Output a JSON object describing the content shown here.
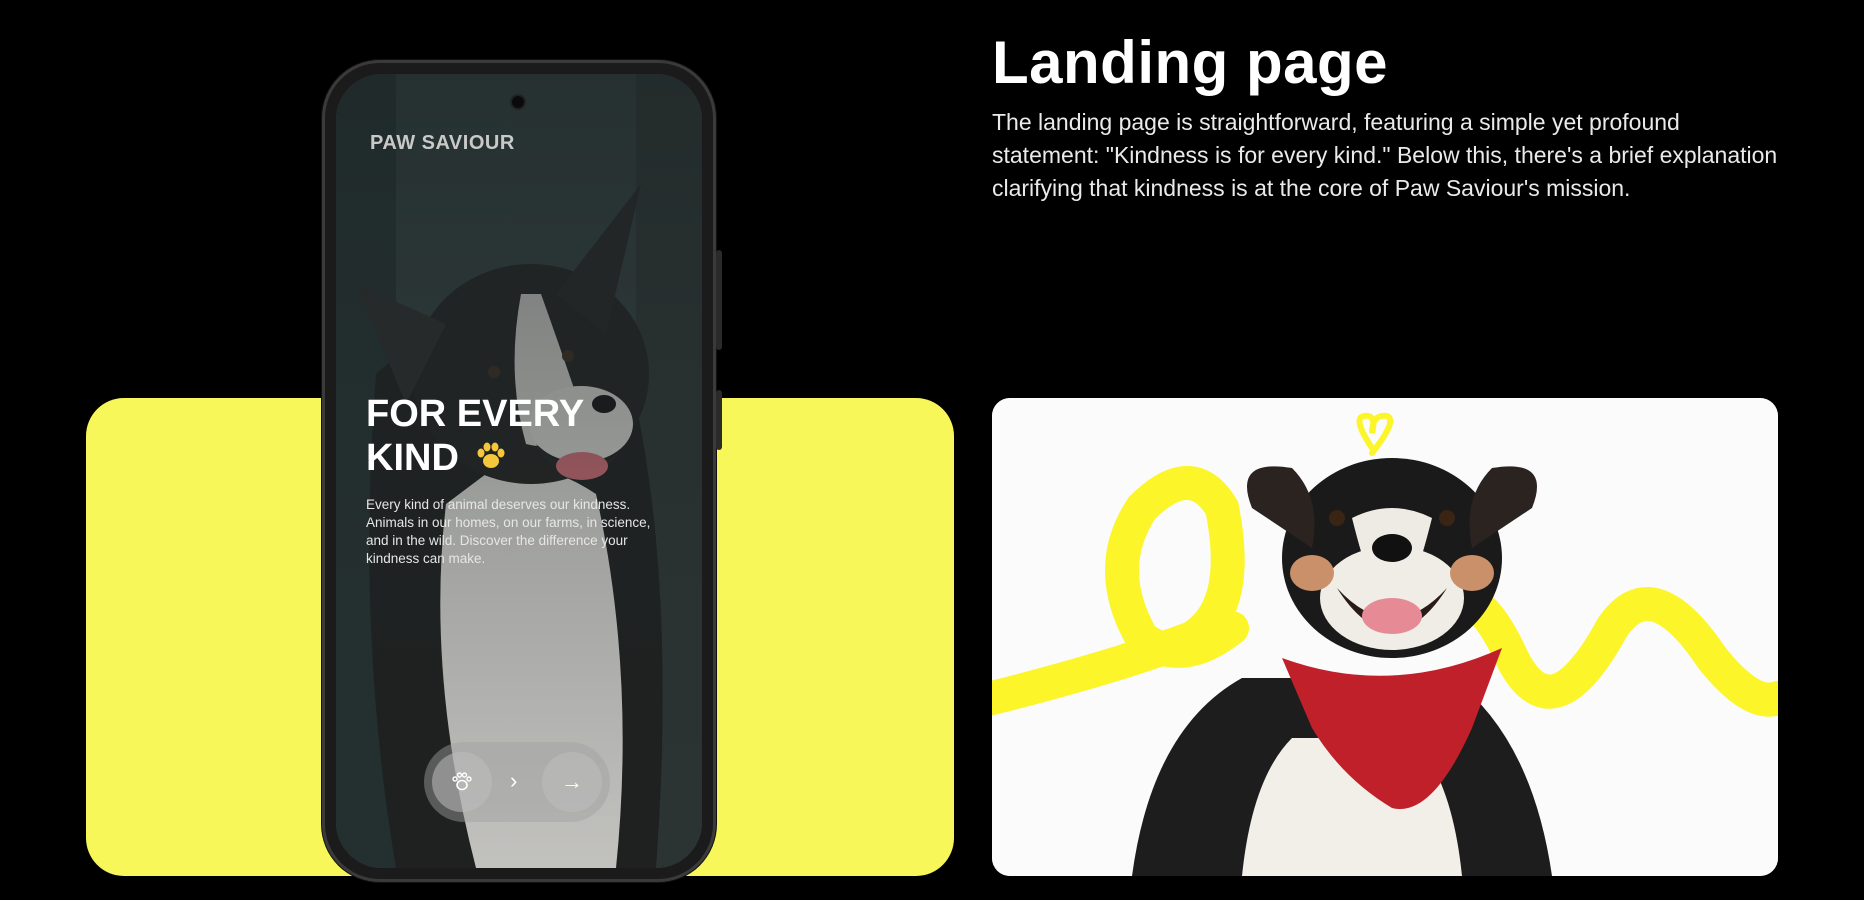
{
  "section": {
    "title": "Landing page",
    "description": "The landing page is straightforward, featuring a simple yet profound statement: \"Kindness is for every kind.\" Below this, there's a brief explanation clarifying that kindness is at the core of Paw Saviour's mission."
  },
  "phone_screen": {
    "brand": "PAW SAVIOUR",
    "headline_line1": "FOR EVERY",
    "headline_line2": "KIND",
    "body": "Every kind of animal deserves our kindness. Animals in our homes, on our farms, in science, and in the wild. Discover the difference your kindness can make.",
    "nav": {
      "chevron": "›",
      "arrow": "→"
    }
  },
  "colors": {
    "background": "#000000",
    "accent_yellow": "#f7f75a",
    "scribble_yellow": "#fbf52a",
    "bandana_red": "#c0202a"
  },
  "icons": [
    "paw-emoji-icon",
    "paw-icon",
    "chevron-right-icon",
    "arrow-right-icon",
    "heart-scribble-icon"
  ]
}
